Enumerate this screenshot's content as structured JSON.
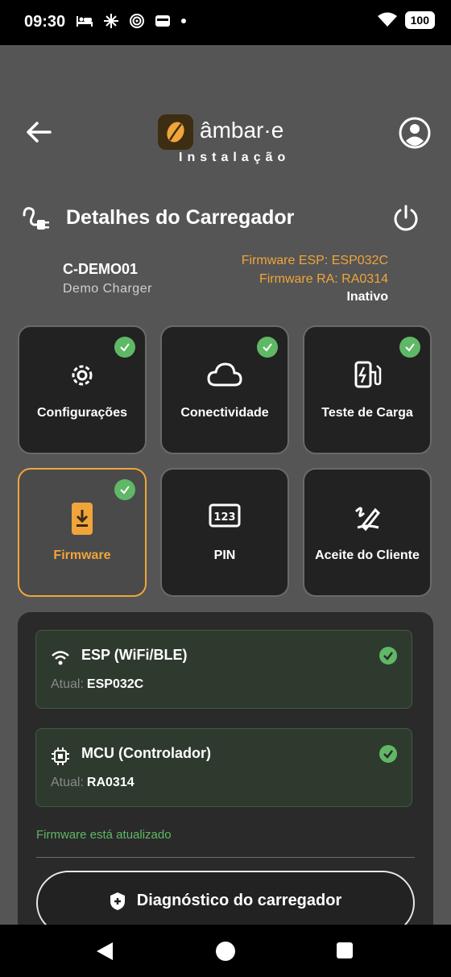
{
  "status_bar": {
    "time": "09:30",
    "battery": "100",
    "icons": [
      "bed-icon",
      "sparkle-icon",
      "target-icon",
      "card-icon",
      "dot-icon",
      "wifi-icon",
      "battery-icon"
    ]
  },
  "header": {
    "brand": "âmbar·e",
    "subtitle": "Instalação",
    "back_icon": "arrow-left-icon",
    "profile_icon": "account-circle-icon"
  },
  "section": {
    "title": "Detalhes do Carregador",
    "icon": "plug-icon",
    "action_icon": "power-icon"
  },
  "charger": {
    "id": "C-DEMO01",
    "name": "Demo Charger",
    "firmware_esp": "Firmware ESP: ESP032C",
    "firmware_ra": "Firmware RA: RA0314",
    "status": "Inativo"
  },
  "tiles": [
    {
      "label": "Configurações",
      "icon": "gear-icon",
      "done": true
    },
    {
      "label": "Conectividade",
      "icon": "cloud-icon",
      "done": true
    },
    {
      "label": "Teste de Carga",
      "icon": "ev-station-icon",
      "done": true
    },
    {
      "label": "Firmware",
      "icon": "phone-download-icon",
      "done": true,
      "active": true
    },
    {
      "label": "PIN",
      "icon": "pin-123-icon",
      "done": false
    },
    {
      "label": "Aceite do Cliente",
      "icon": "signature-icon",
      "done": false
    }
  ],
  "firmware_panel": {
    "cards": [
      {
        "title": "ESP (WiFi/BLE)",
        "current_label": "Atual:",
        "current_value": "ESP032C"
      },
      {
        "title": "MCU (Controlador)",
        "current_label": "Atual:",
        "current_value": "RA0314"
      }
    ],
    "status": "Firmware está atualizado",
    "diagnostic_button": "Diagnóstico do carregador"
  },
  "colors": {
    "accent": "#f0a53a",
    "success": "#5fb865",
    "background": "#555555",
    "tile_bg": "#222222"
  }
}
